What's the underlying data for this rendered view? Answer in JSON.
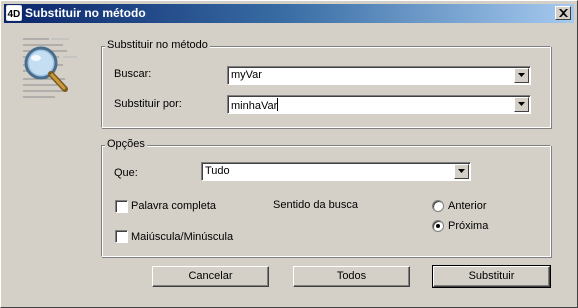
{
  "window": {
    "title": "Substituir no método"
  },
  "icons": {
    "app": "4d-app-icon",
    "close": "close-icon",
    "illustration": "magnifier-document-illustration",
    "dropdown": "chevron-down-icon"
  },
  "colors": {
    "titlebar_start": "#0a246a",
    "titlebar_end": "#a6caf0",
    "dialog_bg": "#d4d0c8"
  },
  "replace_group": {
    "legend": "Substituir no método",
    "find_label": "Buscar:",
    "find_value": "myVar",
    "replace_label": "Substituir por:",
    "replace_value": "minhaVar"
  },
  "options_group": {
    "legend": "Opções",
    "scope_label": "Que:",
    "scope_value": "Tudo",
    "whole_word_label": "Palavra completa",
    "whole_word_checked": false,
    "match_case_label": "Maiúscula/Minúscula",
    "match_case_checked": false,
    "direction_label": "Sentido da busca",
    "direction_previous": "Anterior",
    "direction_next": "Próxima",
    "direction_selected": "Próxima"
  },
  "buttons": {
    "cancel": "Cancelar",
    "all": "Todos",
    "replace": "Substituir"
  }
}
